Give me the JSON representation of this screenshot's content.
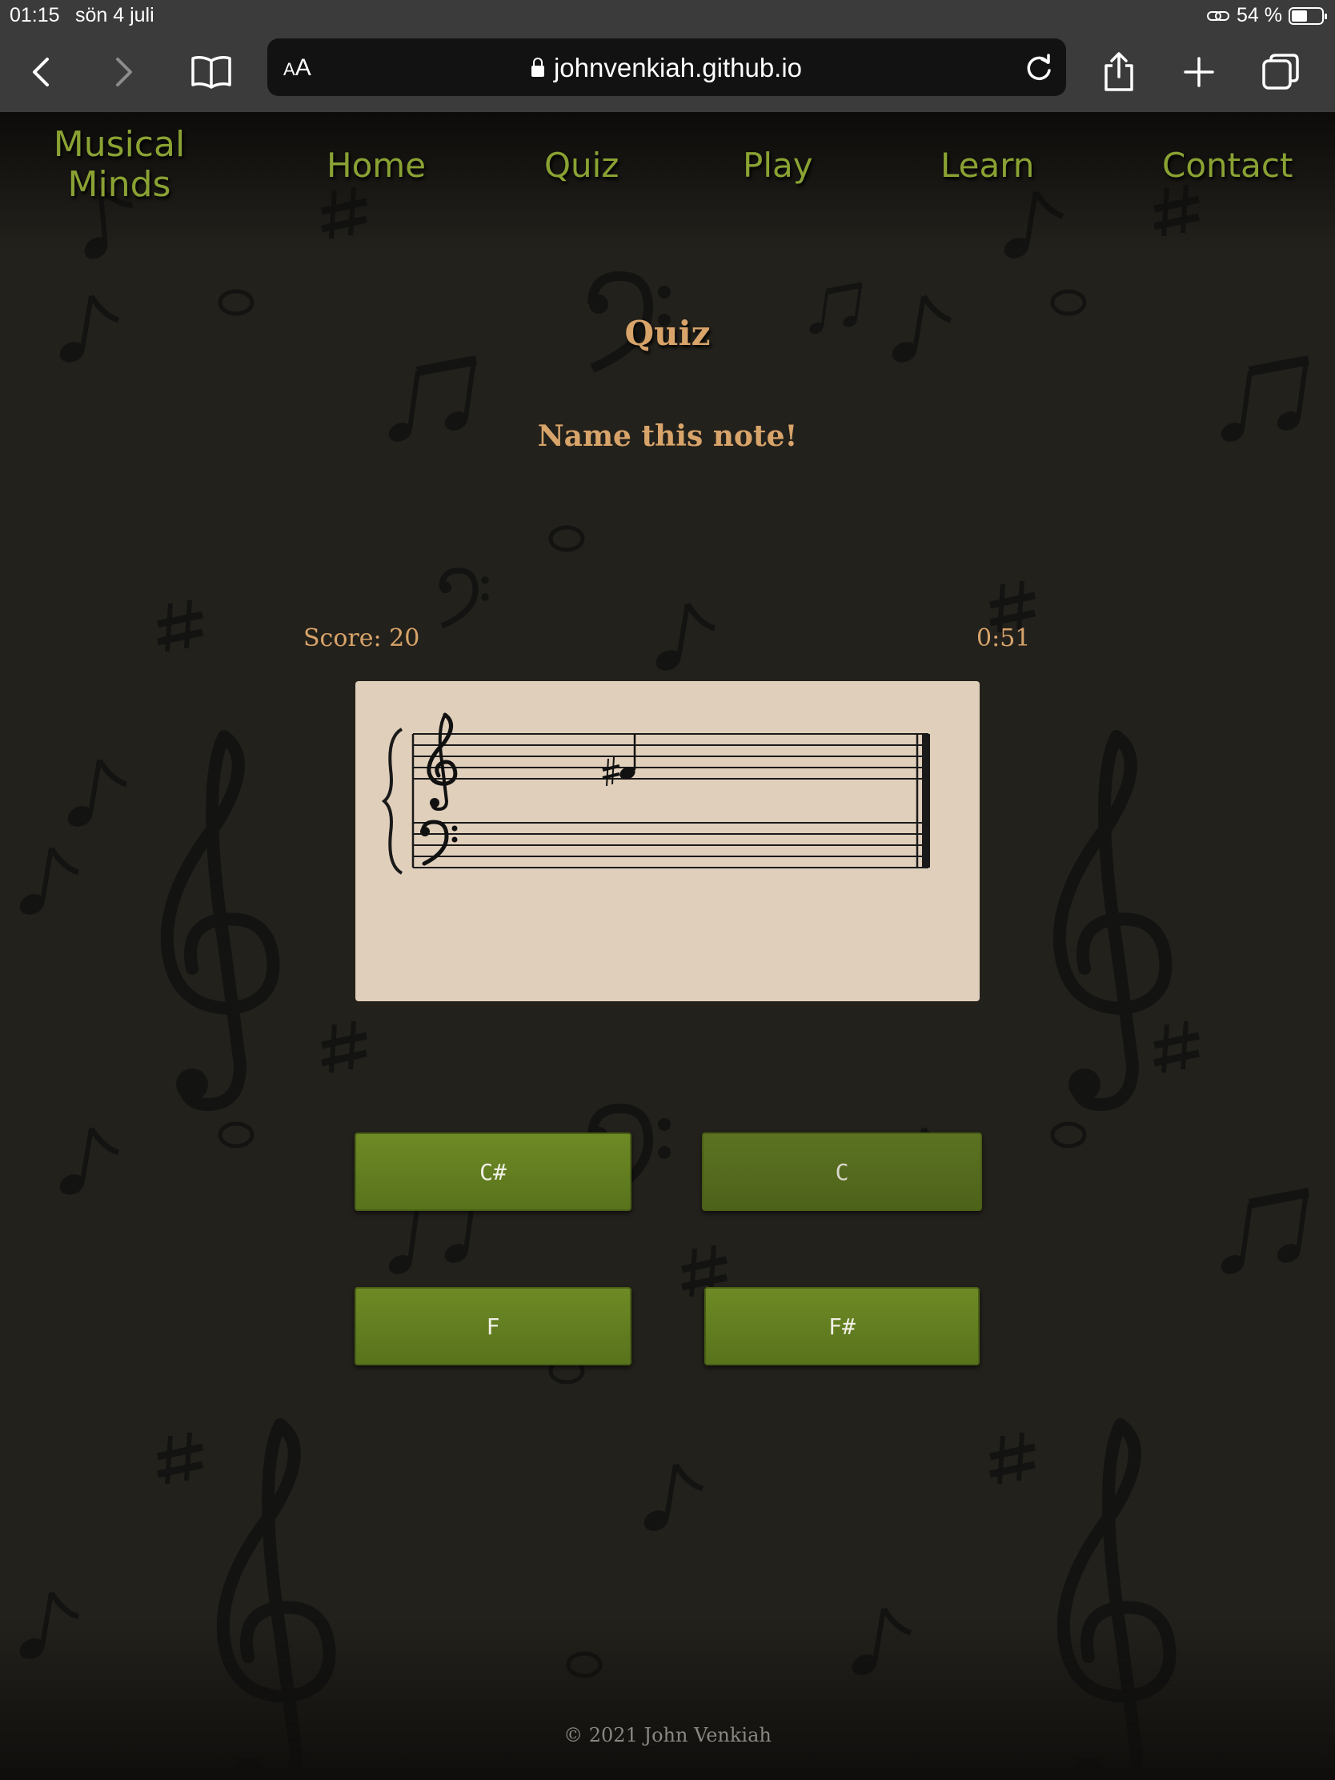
{
  "status_bar": {
    "time": "01:15",
    "date": "sön 4 juli",
    "battery": "54 %",
    "battery_level": 0.54
  },
  "browser": {
    "text_size_label": "AA",
    "url": "johnvenkiah.github.io",
    "back_icon": "chevron-left-icon",
    "forward_icon": "chevron-right-icon",
    "bookmarks_icon": "book-icon",
    "reload_icon": "reload-icon",
    "share_icon": "share-icon",
    "new_tab_icon": "plus-icon",
    "tabs_icon": "tabs-icon"
  },
  "site": {
    "brand_line1": "Musical",
    "brand_line2": "Minds",
    "nav": [
      "Home",
      "Quiz",
      "Play",
      "Learn",
      "Contact"
    ],
    "accent_color": "#8aa233",
    "text_color": "#d8a46a"
  },
  "quiz": {
    "title": "Quiz",
    "prompt": "Name this note!",
    "score": "Score: 20",
    "timer": "0:51",
    "answers": [
      "C#",
      "C",
      "F",
      "F#"
    ]
  },
  "footer": {
    "copyright": "© 2021 John Venkiah"
  }
}
